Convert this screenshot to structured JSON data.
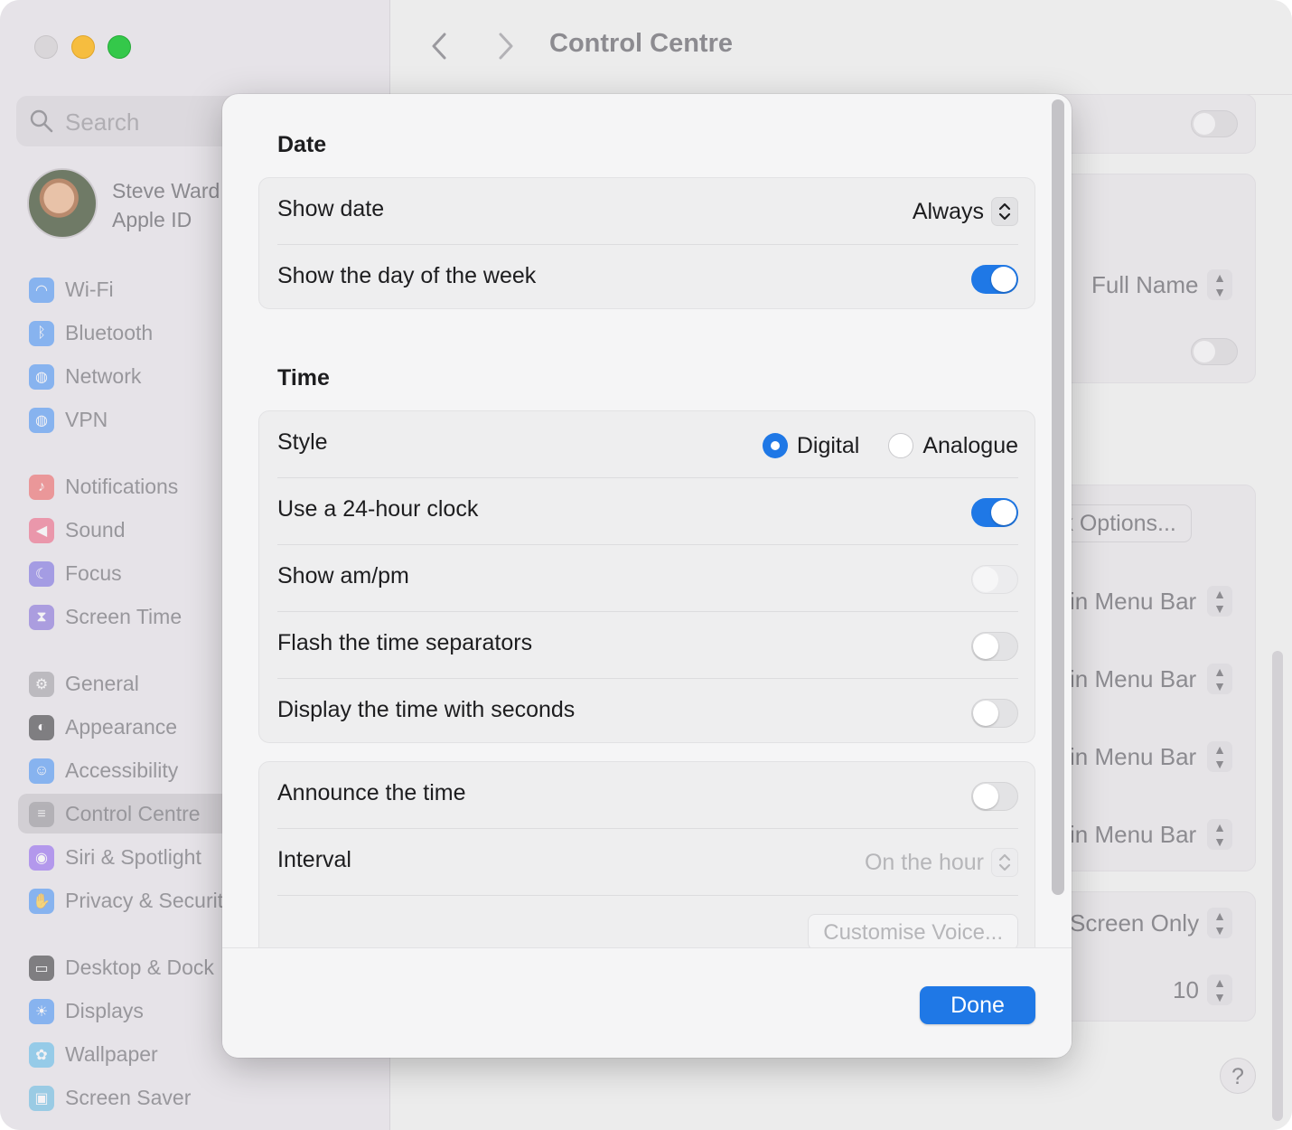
{
  "window": {
    "title": "Control Centre"
  },
  "sidebar": {
    "search_placeholder": "Search",
    "profile": {
      "name": "Steve Ward",
      "subtitle": "Apple ID"
    },
    "items": [
      {
        "label": "Wi-Fi",
        "icon": "wifi-icon",
        "color": "#3b8cf5"
      },
      {
        "label": "Bluetooth",
        "icon": "bluetooth-icon",
        "color": "#3b8cf5"
      },
      {
        "label": "Network",
        "icon": "globe-icon",
        "color": "#3b8cf5"
      },
      {
        "label": "VPN",
        "icon": "vpn-globe-icon",
        "color": "#3b8cf5"
      },
      {
        "label": "Notifications",
        "icon": "bell-icon",
        "color": "#ef5a5a"
      },
      {
        "label": "Sound",
        "icon": "speaker-icon",
        "color": "#ef5a7a"
      },
      {
        "label": "Focus",
        "icon": "moon-icon",
        "color": "#6f63e0"
      },
      {
        "label": "Screen Time",
        "icon": "hourglass-icon",
        "color": "#7b64d8"
      },
      {
        "label": "General",
        "icon": "gear-icon",
        "color": "#9a9a9f"
      },
      {
        "label": "Appearance",
        "icon": "appearance-icon",
        "color": "#2c2c2e"
      },
      {
        "label": "Accessibility",
        "icon": "accessibility-icon",
        "color": "#3b8cf5"
      },
      {
        "label": "Control Centre",
        "icon": "control-centre-icon",
        "color": "#9a9a9f"
      },
      {
        "label": "Siri & Spotlight",
        "icon": "siri-icon",
        "color": "#8a5cf0"
      },
      {
        "label": "Privacy & Securit",
        "icon": "hand-icon",
        "color": "#3b8cf5"
      },
      {
        "label": "Desktop & Dock",
        "icon": "dock-icon",
        "color": "#2c2c2e"
      },
      {
        "label": "Displays",
        "icon": "sun-icon",
        "color": "#3b8cf5"
      },
      {
        "label": "Wallpaper",
        "icon": "flower-icon",
        "color": "#56b8e8"
      },
      {
        "label": "Screen Saver",
        "icon": "screensaver-icon",
        "color": "#5bb8e0"
      }
    ]
  },
  "background": {
    "full_name": "Full Name",
    "clock_options": "ock Options...",
    "menu_bar_1": "in Menu Bar",
    "menu_bar_2": "in Menu Bar",
    "menu_bar_3": "in Menu Bar",
    "menu_bar_4": "in Menu Bar",
    "screen_only": "Screen Only",
    "number": "10",
    "help": "?"
  },
  "sheet": {
    "date_section": {
      "title": "Date",
      "show_date_label": "Show date",
      "show_date_value": "Always",
      "show_day_label": "Show the day of the week",
      "show_day_on": true
    },
    "time_section": {
      "title": "Time",
      "style_label": "Style",
      "style_options": [
        "Digital",
        "Analogue"
      ],
      "style_selected": "Digital",
      "clock24_label": "Use a 24-hour clock",
      "clock24_on": true,
      "ampm_label": "Show am/pm",
      "ampm_on": false,
      "flash_label": "Flash the time separators",
      "flash_on": false,
      "seconds_label": "Display the time with seconds",
      "seconds_on": false
    },
    "announce_section": {
      "announce_label": "Announce the time",
      "announce_on": false,
      "interval_label": "Interval",
      "interval_value": "On the hour",
      "customise_voice": "Customise Voice..."
    },
    "done_label": "Done"
  }
}
